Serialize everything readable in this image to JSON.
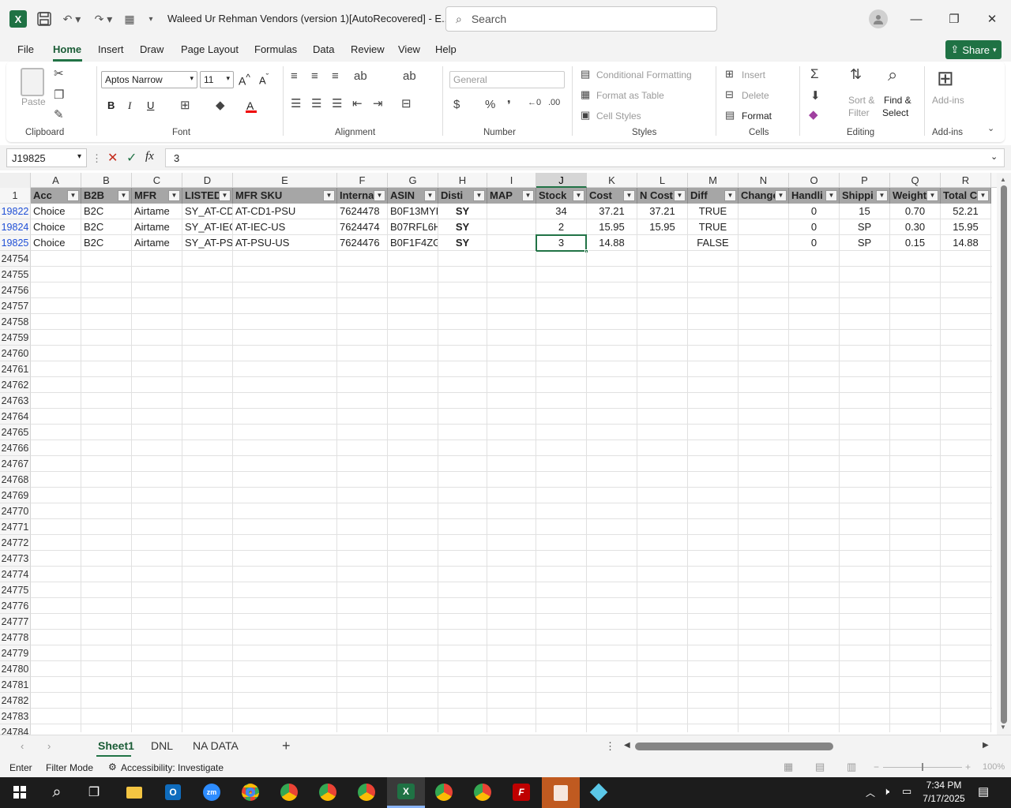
{
  "titlebar": {
    "doc_title": "Waleed Ur Rehman Vendors (version 1)[AutoRecovered]  -  E...",
    "search_placeholder": "Search"
  },
  "menu": {
    "items": [
      "File",
      "Home",
      "Insert",
      "Draw",
      "Page Layout",
      "Formulas",
      "Data",
      "Review",
      "View",
      "Help"
    ],
    "active": "Home",
    "share": "Share"
  },
  "ribbon": {
    "clipboard": {
      "paste": "Paste",
      "label": "Clipboard"
    },
    "font": {
      "name": "Aptos Narrow",
      "size": "11",
      "bold": "B",
      "italic": "I",
      "underline": "U",
      "label": "Font"
    },
    "alignment": {
      "label": "Alignment"
    },
    "number": {
      "format": "General",
      "label": "Number"
    },
    "styles": {
      "conditional": "Conditional Formatting",
      "as_table": "Format as Table",
      "cell_styles": "Cell Styles",
      "label": "Styles"
    },
    "cells": {
      "insert": "Insert",
      "delete": "Delete",
      "format": "Format",
      "label": "Cells"
    },
    "editing": {
      "sort1": "Sort &",
      "sort2": "Filter",
      "find1": "Find &",
      "find2": "Select",
      "label": "Editing"
    },
    "addins": {
      "btn": "Add-ins",
      "label": "Add-ins"
    }
  },
  "formula_bar": {
    "name_box": "J19825",
    "value": "3"
  },
  "columns": [
    "A",
    "B",
    "C",
    "D",
    "E",
    "F",
    "G",
    "H",
    "I",
    "J",
    "K",
    "L",
    "M",
    "N",
    "O",
    "P",
    "Q",
    "R"
  ],
  "selected_column": "J",
  "header_row": {
    "row_number": "1",
    "cells": [
      "Acc",
      "B2B",
      "MFR",
      "LISTED",
      "MFR SKU",
      "Interna",
      "ASIN",
      "Disti",
      "MAP",
      "Stock",
      "Cost",
      "N Cost",
      "Diff",
      "Change",
      "Handli",
      "Shippi",
      "Weight",
      "Total C"
    ]
  },
  "data_rows": [
    {
      "row": "19822",
      "cells": [
        "Choice",
        "B2C",
        "Airtame",
        "SY_AT-CD1",
        "AT-CD1-PSU",
        "7624478",
        "B0F13MYH",
        "SY",
        "",
        "34",
        "37.21",
        "37.21",
        "TRUE",
        "",
        "0",
        "15",
        "0.70",
        "52.21"
      ]
    },
    {
      "row": "19824",
      "cells": [
        "Choice",
        "B2C",
        "Airtame",
        "SY_AT-IEC-",
        "AT-IEC-US",
        "7624474",
        "B07RFL6H",
        "SY",
        "",
        "2",
        "15.95",
        "15.95",
        "TRUE",
        "",
        "0",
        "SP",
        "0.30",
        "15.95"
      ]
    },
    {
      "row": "19825",
      "cells": [
        "Choice",
        "B2C",
        "Airtame",
        "SY_AT-PSU",
        "AT-PSU-US",
        "7624476",
        "B0F1F4ZG\\",
        "SY",
        "",
        "3",
        "14.88",
        "",
        "FALSE",
        "",
        "0",
        "SP",
        "0.15",
        "14.88"
      ]
    }
  ],
  "empty_rows": [
    "24754",
    "24755",
    "24756",
    "24757",
    "24758",
    "24759",
    "24760",
    "24761",
    "24762",
    "24763",
    "24764",
    "24765",
    "24766",
    "24767",
    "24768",
    "24769",
    "24770",
    "24771",
    "24772",
    "24773",
    "24774",
    "24775",
    "24776",
    "24777",
    "24778",
    "24779",
    "24780",
    "24781",
    "24782",
    "24783",
    "24784"
  ],
  "sheet_tabs": {
    "tabs": [
      "Sheet1",
      "DNL",
      "NA DATA"
    ],
    "active": "Sheet1"
  },
  "status_bar": {
    "mode": "Enter",
    "filter": "Filter Mode",
    "accessibility": "Accessibility: Investigate",
    "zoom": "100%"
  },
  "taskbar": {
    "time": "7:34 PM",
    "date": "7/17/2025"
  },
  "colors": {
    "excel_green": "#217346",
    "share_green": "#1f7244",
    "header_fill": "#a6a6a6",
    "row_num_blue": "#1f4fd6",
    "taskbar": "#1c1c1c"
  }
}
